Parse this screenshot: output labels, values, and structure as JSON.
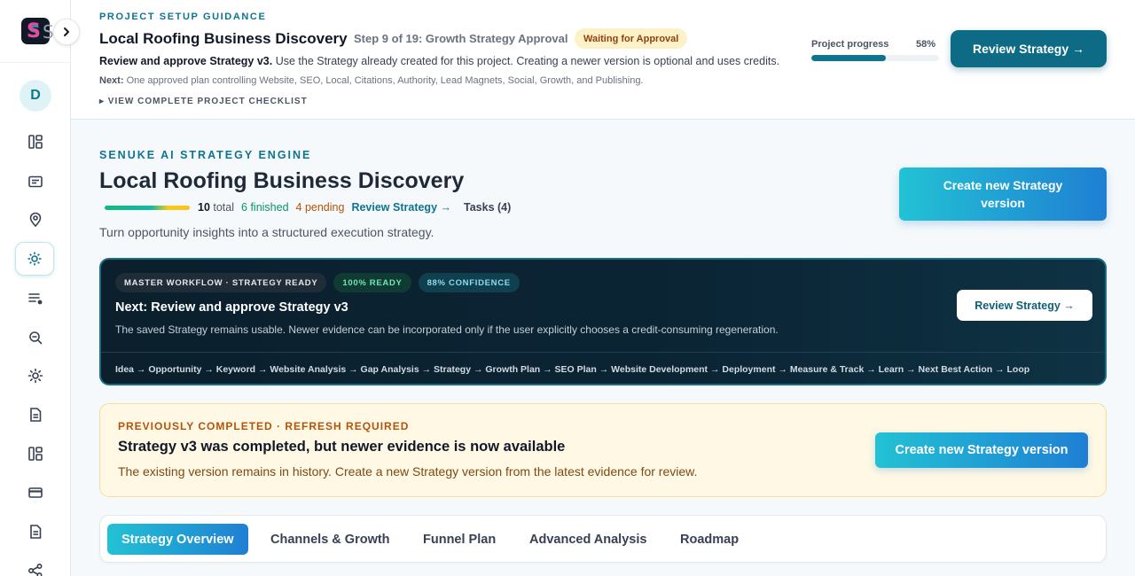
{
  "sidebar": {
    "logo_peek": "S",
    "avatar_initial": "D",
    "nav_icons": [
      "grid-icon",
      "card-icon",
      "map-pin-icon",
      "strategy-icon",
      "list-icon",
      "search-icon",
      "sun-icon",
      "document-icon",
      "grid-icon",
      "credit-card-icon",
      "document-icon",
      "share-icon"
    ],
    "active_index": 3
  },
  "guidance": {
    "eyebrow": "PROJECT SETUP GUIDANCE",
    "title": "Local Roofing Business Discovery",
    "step": "Step 9 of 19: Growth Strategy Approval",
    "status_badge": "Waiting for Approval",
    "instruction_bold": "Review and approve Strategy v3.",
    "instruction_rest": " Use the Strategy already created for this project. Creating a newer version is optional and uses credits.",
    "next_label": "Next:",
    "next_text": " One approved plan controlling Website, SEO, Local, Citations, Authority, Lead Magnets, Social, Growth, and Publishing.",
    "checklist_link": "▸ VIEW COMPLETE PROJECT CHECKLIST",
    "progress_label": "Project progress",
    "progress_text": "58%",
    "progress_value": 58,
    "review_button": "Review Strategy →"
  },
  "main": {
    "eyebrow": "SENUKE AI STRATEGY ENGINE",
    "title": "Local Roofing Business Discovery",
    "stats": {
      "total_num": "10",
      "total_label": " total",
      "finished": "6 finished",
      "pending": "4 pending",
      "review_link": "Review Strategy →",
      "tasks": "Tasks (4)"
    },
    "subtitle": "Turn opportunity insights into a structured execution strategy.",
    "create_button": "Create new Strategy version"
  },
  "workflow": {
    "badges": [
      "MASTER WORKFLOW · STRATEGY READY",
      "100% READY",
      "88% CONFIDENCE"
    ],
    "title": "Next: Review and approve Strategy v3",
    "description": "The saved Strategy remains usable. Newer evidence can be incorporated only if the user explicitly chooses a credit-consuming regeneration.",
    "button": "Review Strategy →",
    "flow": "Idea → Opportunity → Keyword → Website Analysis → Gap Analysis → Strategy → Growth Plan → SEO Plan → Website Development → Deployment → Measure & Track → Learn → Next Best Action → Loop"
  },
  "refresh": {
    "eyebrow": "PREVIOUSLY COMPLETED · REFRESH REQUIRED",
    "title": "Strategy v3 was completed, but newer evidence is now available",
    "description": "The existing version remains in history. Create a new Strategy version from the latest evidence for review.",
    "button": "Create new Strategy version"
  },
  "tabs": [
    "Strategy Overview",
    "Channels & Growth",
    "Funnel Plan",
    "Advanced Analysis",
    "Roadmap"
  ],
  "colors": {
    "accent": "#0e7490",
    "primary_button": "#0e6b86",
    "gradient_start": "#22c2d4",
    "gradient_end": "#1f7fd3",
    "warning_bg": "#fff8e5",
    "dark_card": "#0b2535"
  }
}
